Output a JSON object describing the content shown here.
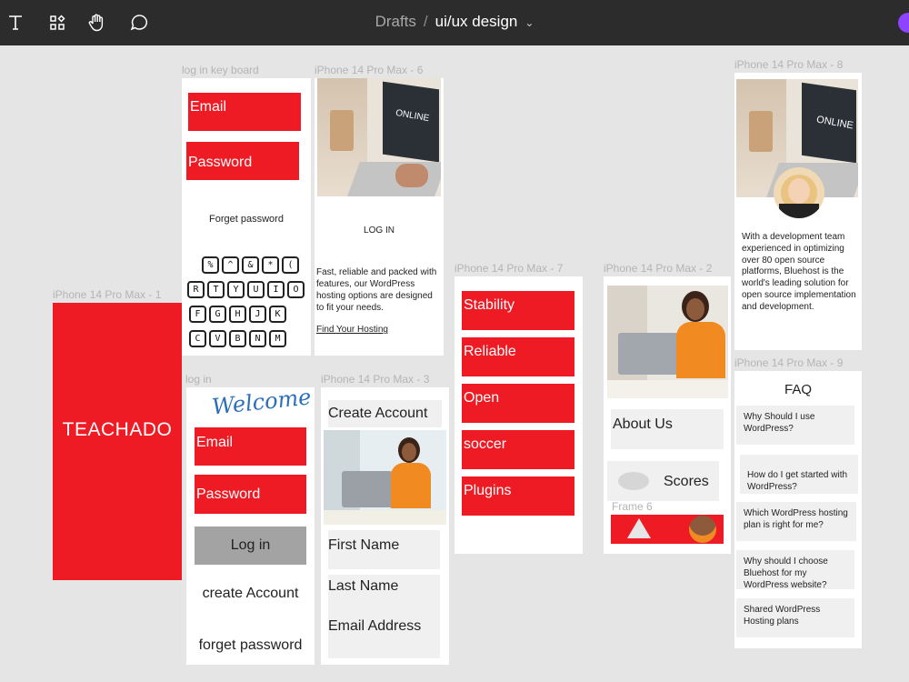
{
  "toolbar": {
    "tools": [
      {
        "name": "text-tool",
        "glyph": "T"
      },
      {
        "name": "components-tool",
        "glyph": "⁘"
      },
      {
        "name": "hand-tool",
        "glyph": "✋"
      },
      {
        "name": "comment-tool",
        "glyph": "💬"
      }
    ],
    "breadcrumb": {
      "parent": "Drafts",
      "separator": "/",
      "file": "ui/ux design"
    }
  },
  "colors": {
    "brand_red": "#ee1b24",
    "topbar": "#2c2c2c",
    "canvas": "#e5e5e5"
  },
  "frames": {
    "f1": {
      "label": "iPhone 14 Pro Max - 1",
      "title": "TEACHADO"
    },
    "login_keyboard": {
      "label": "log in key board",
      "email": "Email",
      "password": "Password",
      "forget": "Forget password"
    },
    "f6": {
      "label": "iPhone 14 Pro Max - 6",
      "photo_text": "ONLINE",
      "login": "LOG IN",
      "body": "Fast, reliable and packed with features, our WordPress hosting options are designed to fit your needs.",
      "link": "Find Your Hosting"
    },
    "login": {
      "label": "log in",
      "welcome": "Welcome",
      "email": "Email",
      "password": "Password",
      "login_btn": "Log in",
      "create": "create Account",
      "forget": "forget password"
    },
    "f3": {
      "label": "iPhone 14 Pro Max - 3",
      "create": "Create Account",
      "first": "First Name",
      "last": "Last Name",
      "email": "Email Address"
    },
    "f7": {
      "label": "iPhone 14 Pro Max - 7",
      "items": [
        "Stability",
        "Reliable",
        "Open",
        "soccer",
        "Plugins"
      ]
    },
    "f2": {
      "label": "iPhone 14 Pro Max - 2",
      "about": "About Us",
      "scores": "Scores",
      "frame6": "Frame 6"
    },
    "f8": {
      "label": "iPhone 14 Pro Max - 8",
      "photo_text": "ONLINE",
      "body": "With a development team experienced in optimizing over 80 open source platforms, Bluehost is the world's leading solution for open source implementation and development."
    },
    "f9": {
      "label": "iPhone 14 Pro Max - 9",
      "title": "FAQ",
      "items": [
        "Why Should I use WordPress?",
        "How do I get started with WordPress?",
        "Which WordPress hosting plan is right for me?",
        "Why should I choose Bluehost for my WordPress website?",
        "Shared WordPress Hosting plans"
      ]
    }
  },
  "keyboard_rows": [
    [
      "%",
      "^",
      "&",
      "*",
      "("
    ],
    [
      "R",
      "T",
      "Y",
      "U",
      "I",
      "O"
    ],
    [
      "F",
      "G",
      "H",
      "J",
      "K"
    ],
    [
      "C",
      "V",
      "B",
      "N",
      "M"
    ]
  ]
}
